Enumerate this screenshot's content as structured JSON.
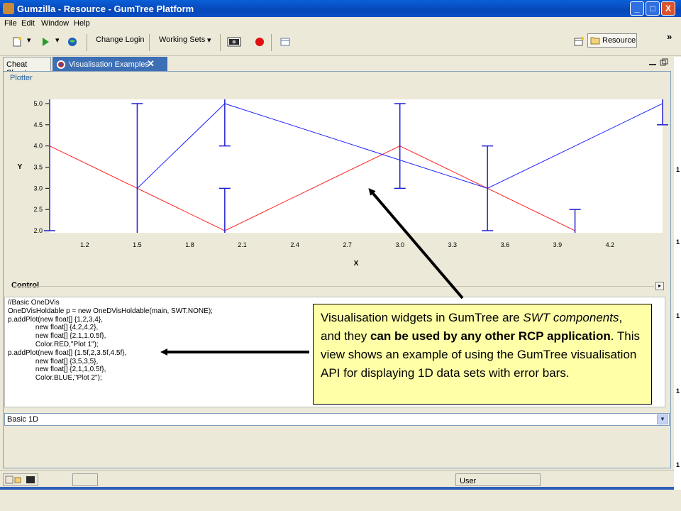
{
  "window": {
    "title": "Gumzilla - Resource - GumTree Platform",
    "minimize": "_",
    "maximize": "□",
    "close": "X"
  },
  "menu": {
    "items": [
      "File",
      "Edit",
      "Window",
      "Help"
    ]
  },
  "toolbar": {
    "change_login": "Change Login",
    "working_sets": "Working Sets",
    "resource": "Resource",
    "overflow": "»",
    "dropdown_glyph": "▾"
  },
  "tabs": [
    {
      "label": "Cheat Sheets"
    },
    {
      "label": "Visualisation Examples",
      "close": "✕"
    }
  ],
  "plotter": {
    "label": "Plotter",
    "chart_data": {
      "type": "line",
      "xlabel": "X",
      "ylabel": "Y",
      "xlim": [
        1.0,
        4.5
      ],
      "ylim": [
        1.95,
        5.1
      ],
      "xticks": [
        "1.2",
        "1.5",
        "1.8",
        "2.1",
        "2.4",
        "2.7",
        "3.0",
        "3.3",
        "3.6",
        "3.9",
        "4.2"
      ],
      "yticks": [
        "2.0",
        "2.5",
        "3.0",
        "3.5",
        "4.0",
        "4.5",
        "5.0"
      ],
      "grid": false,
      "series": [
        {
          "color": "#ff2020",
          "x": [
            1,
            2,
            3,
            4
          ],
          "y": [
            4,
            2,
            4,
            2
          ],
          "err": [
            2,
            1,
            1,
            0.5
          ]
        },
        {
          "color": "#2020ff",
          "x": [
            1.5,
            2,
            3.5,
            4.5
          ],
          "y": [
            3,
            5,
            3,
            5
          ],
          "err": [
            2,
            1,
            1,
            0.5
          ]
        }
      ]
    }
  },
  "control": {
    "label": "Control",
    "collapse_glyph": "▸",
    "code_lines": [
      "//Basic OneDVis",
      "OneDVisHoldable p = new OneDVisHoldable(main, SWT.NONE);",
      "p.addPlot(new float[] {1,2,3,4},",
      "              new float[] {4,2,4,2},",
      "              new float[] {2,1,1,0.5f},",
      "              Color.RED,\"Plot 1\");",
      "p.addPlot(new float[] {1.5f,2,3.5f,4.5f},",
      "              new float[] {3,5,3,5},",
      "              new float[] {2,1,1,0.5f},",
      "              Color.BLUE,\"Plot 2\");"
    ],
    "selector_value": "Basic 1D",
    "selector_arrow": "▼"
  },
  "callout": {
    "t1": "Visualisation widgets in GumTree are ",
    "t2": "SWT components",
    "t3": ", and they ",
    "t4": "can be used by any other RCP application",
    "t5": ".  This view shows an example of using the GumTree visualisation API for displaying 1D data sets with error bars."
  },
  "status": {
    "user": "User"
  },
  "right_edge_marks": [
    "1",
    "1",
    "1",
    "1",
    "1"
  ],
  "colors": {
    "title_bar": "#0a5fd8",
    "active_tab": "#3d6fb5",
    "callout_bg": "#ffffa8",
    "plot_red": "#ff2020",
    "plot_blue": "#2020ff"
  }
}
